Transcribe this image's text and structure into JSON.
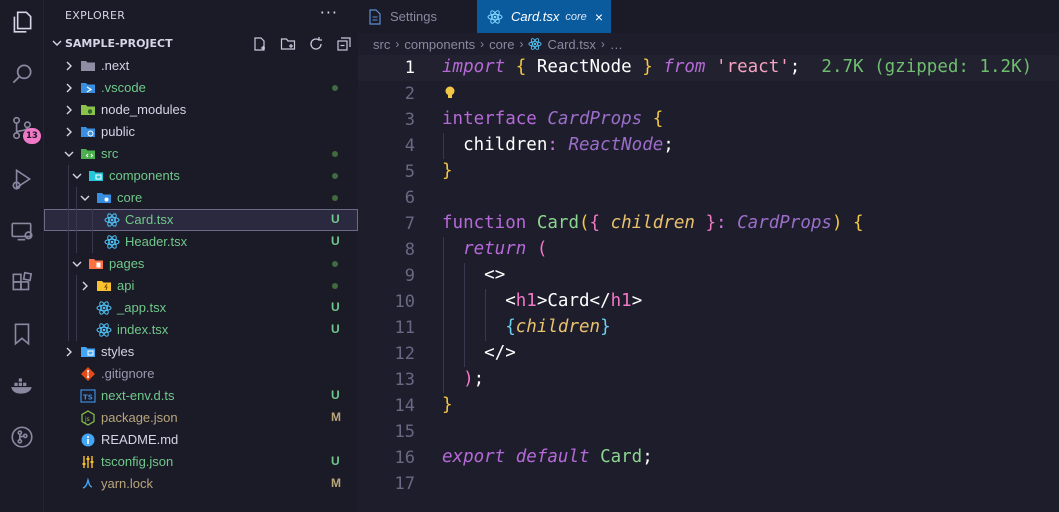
{
  "activity_bar": {
    "icons": [
      "explorer-icon",
      "search-icon",
      "source-control-icon",
      "run-debug-icon",
      "remote-explorer-icon",
      "extensions-icon",
      "bookmarks-icon",
      "docker-icon",
      "gitlens-icon"
    ],
    "source_control_badge": "13",
    "accent_color": "#f178c6"
  },
  "sidebar": {
    "title": "EXPLORER",
    "more": "···",
    "project": "SAMPLE-PROJECT",
    "items": [
      {
        "label": ".next",
        "status": "",
        "dot": false
      },
      {
        "label": ".vscode",
        "status": "",
        "dot": true
      },
      {
        "label": "node_modules",
        "status": "",
        "dot": false
      },
      {
        "label": "public",
        "status": "",
        "dot": false
      },
      {
        "label": "src",
        "status": "",
        "dot": true
      },
      {
        "label": "components",
        "status": "",
        "dot": true
      },
      {
        "label": "core",
        "status": "",
        "dot": true
      },
      {
        "label": "Card.tsx",
        "status": "U",
        "dot": false
      },
      {
        "label": "Header.tsx",
        "status": "U",
        "dot": false
      },
      {
        "label": "pages",
        "status": "",
        "dot": true
      },
      {
        "label": "api",
        "status": "",
        "dot": true
      },
      {
        "label": "_app.tsx",
        "status": "U",
        "dot": false
      },
      {
        "label": "index.tsx",
        "status": "U",
        "dot": false
      },
      {
        "label": "styles",
        "status": "",
        "dot": false
      },
      {
        "label": ".gitignore",
        "status": "",
        "dot": false
      },
      {
        "label": "next-env.d.ts",
        "status": "U",
        "dot": false
      },
      {
        "label": "package.json",
        "status": "M",
        "dot": false
      },
      {
        "label": "README.md",
        "status": "",
        "dot": false
      },
      {
        "label": "tsconfig.json",
        "status": "U",
        "dot": false
      },
      {
        "label": "yarn.lock",
        "status": "M",
        "dot": false
      }
    ]
  },
  "tabs": [
    {
      "label": "Settings",
      "active": false
    },
    {
      "label": "Card.tsx",
      "description": "core",
      "active": true,
      "close": "×"
    }
  ],
  "breadcrumb": [
    "src",
    "components",
    "core",
    "Card.tsx",
    "…"
  ],
  "editor": {
    "line_numbers": [
      "1",
      "2",
      "3",
      "4",
      "5",
      "6",
      "7",
      "8",
      "9",
      "10",
      "11",
      "12",
      "13",
      "14",
      "15",
      "16",
      "17"
    ],
    "import_cost": "2.7K (gzipped: 1.2K)",
    "tokens": {
      "import": "import",
      "ob": "{",
      "reactnode": "ReactNode",
      "cb": "}",
      "from": "from",
      "react": "'react'",
      "semi": ";",
      "interface": "interface",
      "cardprops": "CardProps",
      "children": "children",
      "colon": ":",
      "function": "function",
      "card": "Card",
      "lparen": "(",
      "rparen": ")",
      "return": "return",
      "frag_open": "<>",
      "h1_lt": "<",
      "h1": "h1",
      "gt": ">",
      "card_text": "Card",
      "close_lt": "</",
      "frag_close": "</>",
      "export": "export",
      "default": "default"
    }
  }
}
